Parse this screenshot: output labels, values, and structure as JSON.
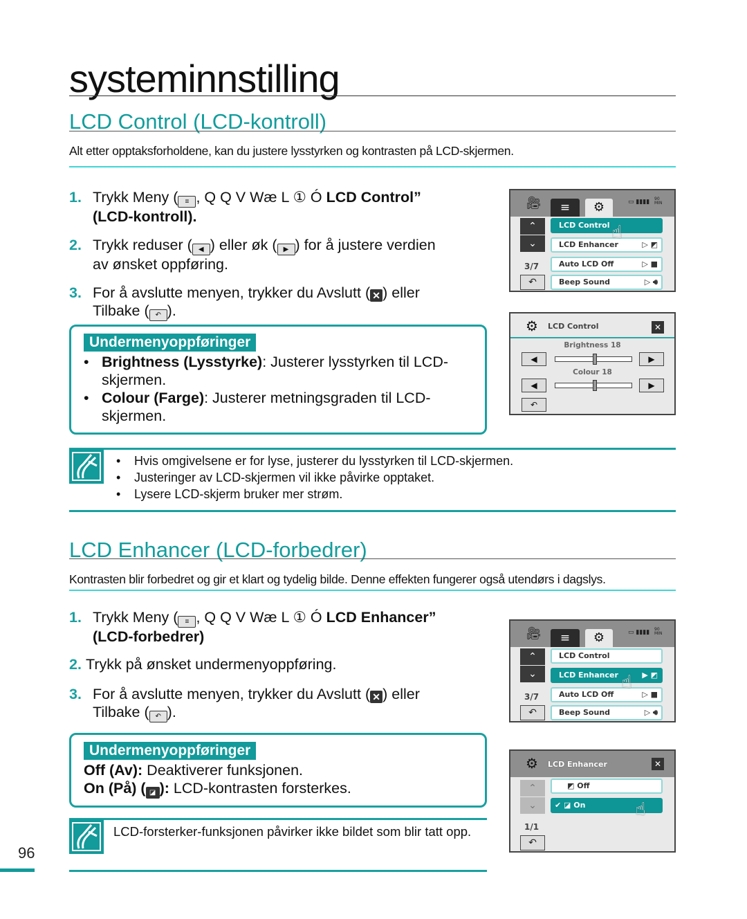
{
  "page": {
    "title": "systeminnstilling",
    "page_number": "96"
  },
  "lcd_control": {
    "heading": "LCD Control (LCD-kontroll)",
    "intro": "Alt etter opptaksforholdene, kan du justere lysstyrken og kontrasten på LCD-skjermen.",
    "steps": [
      {
        "num": "1.",
        "pre": "Trykk Meny (",
        "mid": ", Q Q V Wæ L ① Ó ",
        "bold": "LCD Control”",
        "line2": "(LCD-kontroll)."
      },
      {
        "num": "2.",
        "a": "Trykk reduser (",
        "b": ") eller øk (",
        "c": ") for å justere verdien",
        "line2": "av ønsket oppføring."
      },
      {
        "num": "3.",
        "a": "For å avslutte menyen, trykker du Avslutt (",
        "b": ") eller",
        "line2a": "Tilbake (",
        "line2b": ")."
      }
    ],
    "submenu": {
      "header": "Undermenyoppføringer",
      "items": [
        {
          "term": "Brightness (Lysstyrke)",
          "desc": ": Justerer lysstyrken til LCD-",
          "desc2": "skjermen."
        },
        {
          "term": "Colour (Farge)",
          "desc": ": Justerer metningsgraden til LCD-",
          "desc2": "skjermen."
        }
      ]
    },
    "notes": [
      "Hvis omgivelsene er for lyse, justerer du lysstyrken til LCD-skjermen.",
      "Justeringer av LCD-skjermen vil ikke påvirke opptaket.",
      "Lysere LCD-skjerm bruker mer strøm."
    ]
  },
  "lcd_enhancer": {
    "heading": "LCD Enhancer (LCD-forbedrer)",
    "intro": "Kontrasten blir forbedret og gir et klart og tydelig bilde. Denne effekten fungerer også utendørs i dagslys.",
    "steps": [
      {
        "num": "1.",
        "pre": "Trykk Meny (",
        "mid": ", Q Q V Wæ L ① Ó ",
        "bold": "LCD Enhancer”",
        "line2": "(LCD-forbedrer)"
      },
      {
        "num": "2.",
        "text": "Trykk på ønsket undermenyoppføring."
      },
      {
        "num": "3.",
        "a": "For å avslutte menyen, trykker du Avslutt (",
        "b": ") eller",
        "line2a": "Tilbake (",
        "line2b": ")."
      }
    ],
    "submenu": {
      "header": "Undermenyoppføringer",
      "items": [
        {
          "term": "Off (Av):",
          "desc": " Deaktiverer funksjonen."
        },
        {
          "term": "On (På) (",
          "term2": "):",
          "desc": " LCD-kontrasten forsterkes."
        }
      ]
    },
    "notes": [
      "LCD-forsterker-funksjonen påvirker ikke bildet som blir tatt opp."
    ]
  },
  "screens": {
    "menu": {
      "items": [
        "LCD Control",
        "LCD Enhancer",
        "Auto LCD Off",
        "Beep Sound"
      ],
      "page": "3/7",
      "battery_label": "90 MIN"
    },
    "lcd_control": {
      "title": "LCD Control",
      "brightness_label": "Brightness 18",
      "brightness_value": 18,
      "colour_label": "Colour 18",
      "colour_value": 18,
      "slider_max": 35
    },
    "lcd_enhancer": {
      "title": "LCD Enhancer",
      "options": [
        "Off",
        "On"
      ],
      "selected": "On",
      "page": "1/1"
    }
  },
  "icons": {
    "up": "▲",
    "down": "▼",
    "left": "◀",
    "right": "▶",
    "back": "↶",
    "close": "✖",
    "gear": "⚙",
    "menu": "≡",
    "camera": "▣",
    "play": "▷",
    "check": "✔"
  }
}
